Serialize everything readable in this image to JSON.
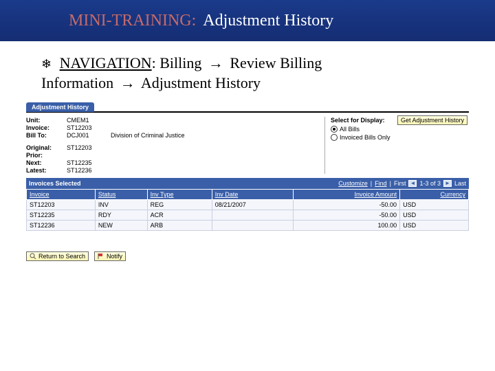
{
  "banner": {
    "prefix": "MINI-TRAINING:",
    "title": "Adjustment History"
  },
  "nav": {
    "label": "NAVIGATION",
    "p1": "Billing",
    "p2": "Review Billing",
    "p3": "Information",
    "p4": "Adjustment History"
  },
  "tab": {
    "label": "Adjustment History"
  },
  "info": {
    "unit_lbl": "Unit:",
    "unit": "CMEM1",
    "invoice_lbl": "Invoice:",
    "invoice": "ST12203",
    "billto_lbl": "Bill To:",
    "billto_code": "DCJ001",
    "billto_name": "Division of Criminal Justice",
    "original_lbl": "Original:",
    "original": "ST12203",
    "prior_lbl": "Prior:",
    "prior": "",
    "next_lbl": "Next:",
    "next": "ST12235",
    "latest_lbl": "Latest:",
    "latest": "ST12236"
  },
  "display": {
    "title": "Select for Display:",
    "opt_all": "All Bills",
    "opt_inv": "Invoiced Bills Only",
    "button": "Get Adjustment History"
  },
  "gridbar": {
    "title": "Invoices Selected",
    "customize": "Customize",
    "find": "Find",
    "first": "First",
    "pager": "1-3 of 3",
    "last": "Last"
  },
  "cols": {
    "invoice": "Invoice",
    "status": "Status",
    "invtype": "Inv Type",
    "invdate": "Inv Date",
    "amount": "Invoice Amount",
    "currency": "Currency"
  },
  "rows": [
    {
      "invoice": "ST12203",
      "status": "INV",
      "invtype": "REG",
      "invdate": "08/21/2007",
      "amount": "-50.00",
      "currency": "USD"
    },
    {
      "invoice": "ST12235",
      "status": "RDY",
      "invtype": "ACR",
      "invdate": "",
      "amount": "-50.00",
      "currency": "USD"
    },
    {
      "invoice": "ST12236",
      "status": "NEW",
      "invtype": "ARB",
      "invdate": "",
      "amount": "100.00",
      "currency": "USD"
    }
  ],
  "footer": {
    "return": "Return to Search",
    "notify": "Notify"
  }
}
